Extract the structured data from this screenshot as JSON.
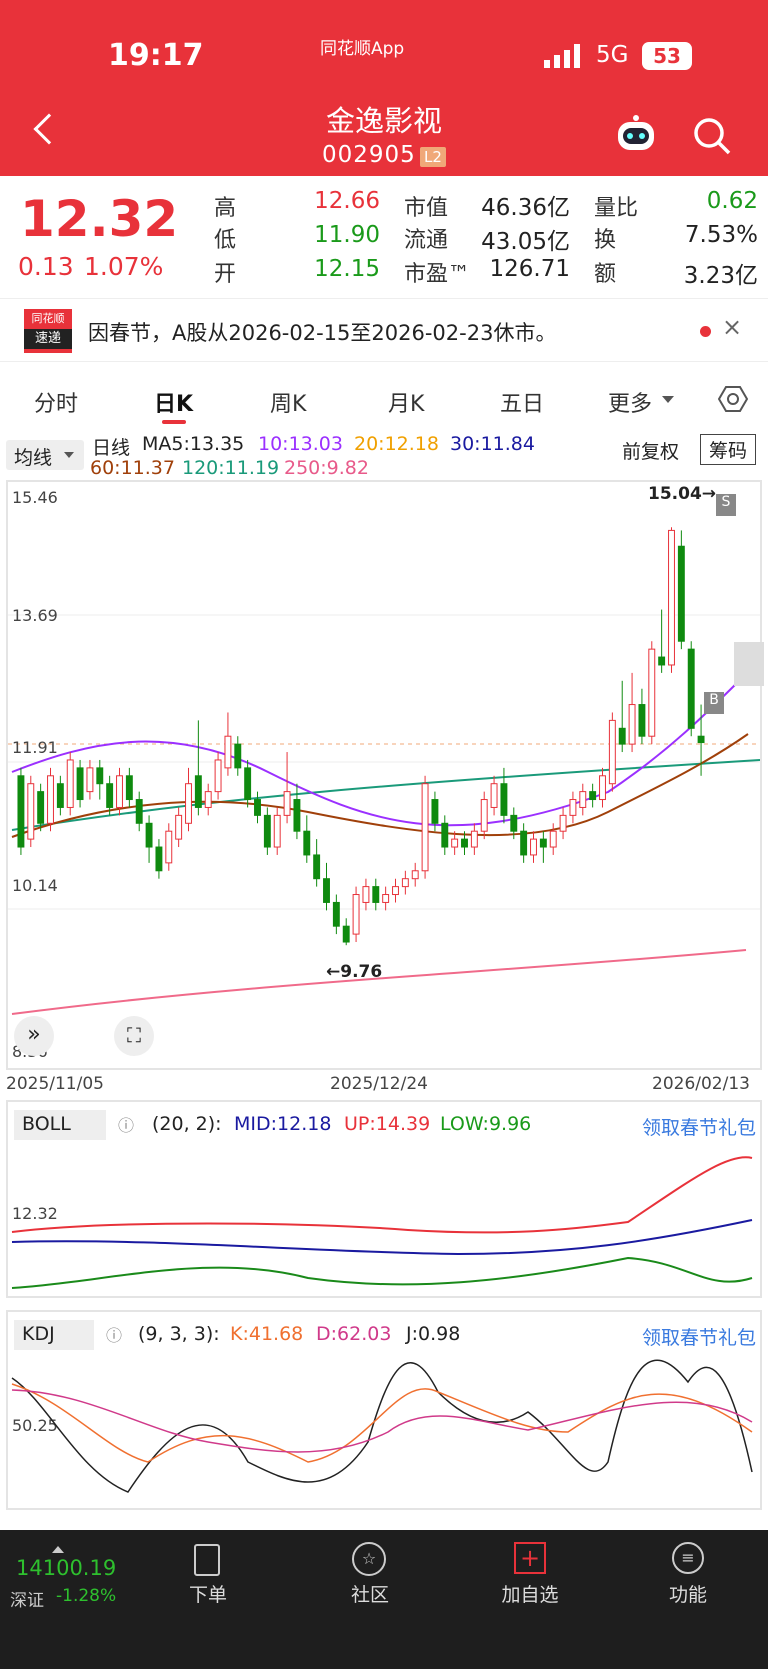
{
  "status": {
    "time": "19:17",
    "app": "同花顺App",
    "network": "5G",
    "battery": "53"
  },
  "stock": {
    "name": "金逸影视",
    "code": "002905",
    "level": "L2",
    "price": "12.32",
    "change": "0.13",
    "change_pct": "1.07%"
  },
  "quote": {
    "high_label": "高",
    "high": "12.66",
    "low_label": "低",
    "low": "11.90",
    "open_label": "开",
    "open": "12.15",
    "mktcap_label": "市值",
    "mktcap": "46.36亿",
    "float_label": "流通",
    "float": "43.05亿",
    "pe_label": "市盈™",
    "pe": "126.71",
    "vr_label": "量比",
    "vr": "0.62",
    "turn_label": "换",
    "turn": "7.53%",
    "amount_label": "额",
    "amount": "3.23亿"
  },
  "notice": {
    "badge_top": "同花顺",
    "badge_bottom": "速递",
    "text": "因春节，A股从2026-02-15至2026-02-23休市。"
  },
  "tabs": [
    "分时",
    "日K",
    "周K",
    "月K",
    "五日",
    "更多"
  ],
  "ma": {
    "selector": "均线",
    "period": "日线",
    "ma5": "MA5:13.35",
    "ma10": "10:13.03",
    "ma20": "20:12.18",
    "ma30": "30:11.84",
    "ma60": "60:11.37",
    "ma120": "120:11.19",
    "ma250": "250:9.82",
    "adjust": "前复权",
    "chip": "筹码"
  },
  "kaxis": {
    "y1": "15.46",
    "y2": "13.69",
    "y3": "11.91",
    "y4": "10.14",
    "y5": "8.36",
    "d1": "2025/11/05",
    "d2": "2025/12/24",
    "d3": "2026/02/13",
    "high_mark": "15.04→",
    "low_mark": "←9.76",
    "flag_s": "S",
    "flag_b": "B"
  },
  "boll": {
    "name": "BOLL",
    "params": "(20, 2):",
    "mid": "MID:12.18",
    "up": "UP:14.39",
    "low": "LOW:9.96",
    "gift": "领取春节礼包",
    "axis": "12.32"
  },
  "kdj": {
    "name": "KDJ",
    "params": "(9, 3, 3):",
    "k": "K:41.68",
    "d": "D:62.03",
    "j": "J:0.98",
    "gift": "领取春节礼包",
    "axis": "50.25"
  },
  "index": {
    "value": "14100.19",
    "name": "深证",
    "pct": "-1.28%"
  },
  "nav": [
    "下单",
    "社区",
    "加自选",
    "功能"
  ],
  "colors": {
    "red": "#e8323a",
    "green": "#1a9a1a"
  },
  "chart_data": {
    "type": "candlestick",
    "ohlc": [
      [
        11.9,
        11.0,
        12.0,
        10.9
      ],
      [
        11.1,
        11.8,
        11.9,
        11.0
      ],
      [
        11.7,
        11.3,
        11.8,
        11.2
      ],
      [
        11.3,
        11.9,
        12.0,
        11.2
      ],
      [
        11.8,
        11.5,
        11.9,
        11.4
      ],
      [
        11.5,
        12.1,
        12.2,
        11.4
      ],
      [
        12.0,
        11.6,
        12.1,
        11.5
      ],
      [
        11.7,
        12.0,
        12.1,
        11.6
      ],
      [
        12.0,
        11.8,
        12.1,
        11.6
      ],
      [
        11.8,
        11.5,
        11.9,
        11.4
      ],
      [
        11.5,
        11.9,
        12.0,
        11.4
      ],
      [
        11.9,
        11.6,
        12.0,
        11.5
      ],
      [
        11.6,
        11.3,
        11.7,
        11.2
      ],
      [
        11.3,
        11.0,
        11.4,
        10.8
      ],
      [
        11.0,
        10.7,
        11.1,
        10.6
      ],
      [
        10.8,
        11.2,
        11.3,
        10.7
      ],
      [
        11.1,
        11.4,
        11.5,
        11.0
      ],
      [
        11.3,
        11.8,
        12.0,
        11.2
      ],
      [
        11.9,
        11.5,
        12.6,
        11.4
      ],
      [
        11.5,
        11.7,
        11.8,
        11.4
      ],
      [
        11.7,
        12.1,
        12.2,
        11.6
      ],
      [
        12.0,
        12.4,
        12.7,
        11.9
      ],
      [
        12.3,
        12.0,
        12.4,
        11.9
      ],
      [
        12.0,
        11.6,
        12.1,
        11.5
      ],
      [
        11.6,
        11.4,
        11.7,
        11.3
      ],
      [
        11.4,
        11.0,
        11.5,
        10.9
      ],
      [
        11.0,
        11.4,
        11.5,
        10.9
      ],
      [
        11.4,
        11.7,
        12.2,
        11.3
      ],
      [
        11.6,
        11.2,
        11.8,
        11.1
      ],
      [
        11.2,
        10.9,
        11.4,
        10.8
      ],
      [
        10.9,
        10.6,
        11.1,
        10.5
      ],
      [
        10.6,
        10.3,
        10.8,
        10.2
      ],
      [
        10.3,
        10.0,
        10.4,
        9.9
      ],
      [
        10.0,
        9.8,
        10.1,
        9.76
      ],
      [
        9.9,
        10.4,
        10.5,
        9.8
      ],
      [
        10.3,
        10.5,
        10.6,
        10.2
      ],
      [
        10.5,
        10.3,
        10.6,
        10.2
      ],
      [
        10.3,
        10.4,
        10.5,
        10.2
      ],
      [
        10.4,
        10.5,
        10.6,
        10.3
      ],
      [
        10.5,
        10.6,
        10.7,
        10.4
      ],
      [
        10.6,
        10.7,
        10.8,
        10.5
      ],
      [
        10.7,
        11.8,
        11.9,
        10.6
      ],
      [
        11.6,
        11.3,
        11.7,
        11.2
      ],
      [
        11.3,
        11.0,
        11.4,
        10.9
      ],
      [
        11.0,
        11.1,
        11.2,
        10.9
      ],
      [
        11.1,
        11.0,
        11.2,
        10.9
      ],
      [
        11.0,
        11.2,
        11.3,
        10.9
      ],
      [
        11.2,
        11.6,
        11.7,
        11.1
      ],
      [
        11.5,
        11.8,
        11.9,
        11.4
      ],
      [
        11.8,
        11.4,
        12.0,
        11.3
      ],
      [
        11.4,
        11.2,
        11.5,
        11.1
      ],
      [
        11.2,
        10.9,
        11.3,
        10.8
      ],
      [
        10.9,
        11.1,
        11.2,
        10.8
      ],
      [
        11.1,
        11.0,
        11.2,
        10.8
      ],
      [
        11.0,
        11.2,
        11.3,
        10.9
      ],
      [
        11.2,
        11.4,
        11.5,
        11.1
      ],
      [
        11.4,
        11.6,
        11.7,
        11.3
      ],
      [
        11.5,
        11.7,
        11.8,
        11.4
      ],
      [
        11.7,
        11.6,
        11.8,
        11.5
      ],
      [
        11.6,
        11.9,
        12.0,
        11.5
      ],
      [
        11.8,
        12.6,
        12.7,
        11.7
      ],
      [
        12.5,
        12.3,
        13.1,
        12.2
      ],
      [
        12.3,
        12.8,
        13.2,
        12.2
      ],
      [
        12.8,
        12.4,
        13.0,
        12.3
      ],
      [
        12.4,
        13.5,
        13.6,
        12.3
      ],
      [
        13.4,
        13.3,
        14.0,
        13.2
      ],
      [
        13.3,
        15.0,
        15.04,
        13.2
      ],
      [
        14.8,
        13.6,
        15.0,
        13.5
      ],
      [
        13.5,
        12.5,
        13.6,
        12.4
      ],
      [
        12.4,
        12.32,
        12.8,
        11.9
      ]
    ]
  }
}
